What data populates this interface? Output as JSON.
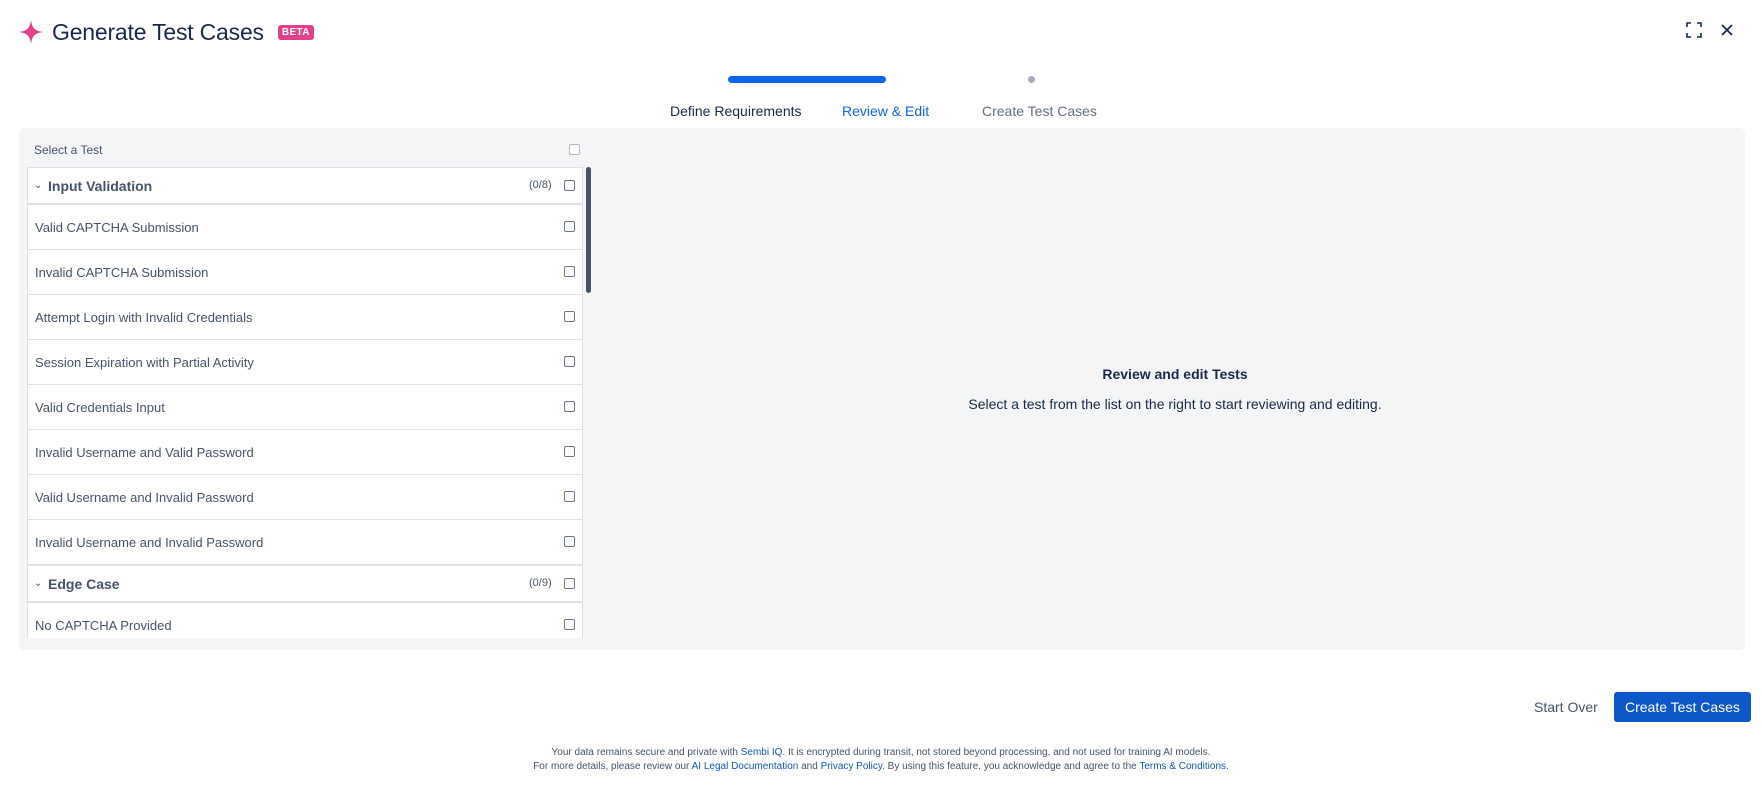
{
  "header": {
    "title": "Generate Test Cases",
    "badge": "BETA",
    "icon": "sparkle-icon",
    "accent_color": "#e2408a"
  },
  "window_controls": {
    "expand_icon": "expand-icon",
    "close_icon": "close-icon"
  },
  "stepper": {
    "steps": [
      {
        "label": "Define Requirements",
        "state": "completed"
      },
      {
        "label": "Review & Edit",
        "state": "active"
      },
      {
        "label": "Create Test Cases",
        "state": "pending"
      }
    ],
    "active_color": "#0c66e4"
  },
  "test_list": {
    "header": "Select a Test",
    "groups": [
      {
        "name": "Input Validation",
        "count": "(0/8)",
        "items": [
          "Valid CAPTCHA Submission",
          "Invalid CAPTCHA Submission",
          "Attempt Login with Invalid Credentials",
          "Session Expiration with Partial Activity",
          "Valid Credentials Input",
          "Invalid Username and Valid Password",
          "Valid Username and Invalid Password",
          "Invalid Username and Invalid Password"
        ]
      },
      {
        "name": "Edge Case",
        "count": "(0/9)",
        "items": [
          "No CAPTCHA Provided"
        ]
      }
    ]
  },
  "empty_state": {
    "title": "Review and edit Tests",
    "description": "Select a test from the list on the right to start reviewing and editing."
  },
  "actions": {
    "start_over": "Start Over",
    "create": "Create Test Cases",
    "primary_color": "#0c58c9"
  },
  "footer": {
    "line1_pre": "Your data remains secure and private with ",
    "line1_link": "Sembi IQ",
    "line1_post": ". It is encrypted during transit, not stored beyond processing, and not used for training AI models.",
    "line2_pre": "For more details, please review our ",
    "line2_link1": "AI Legal Documentation",
    "line2_mid1": " and ",
    "line2_link2": "Privacy Policy",
    "line2_mid2": ". By using this feature, you acknowledge and agree to the ",
    "line2_link3": "Terms & Conditions",
    "line2_post": "."
  }
}
